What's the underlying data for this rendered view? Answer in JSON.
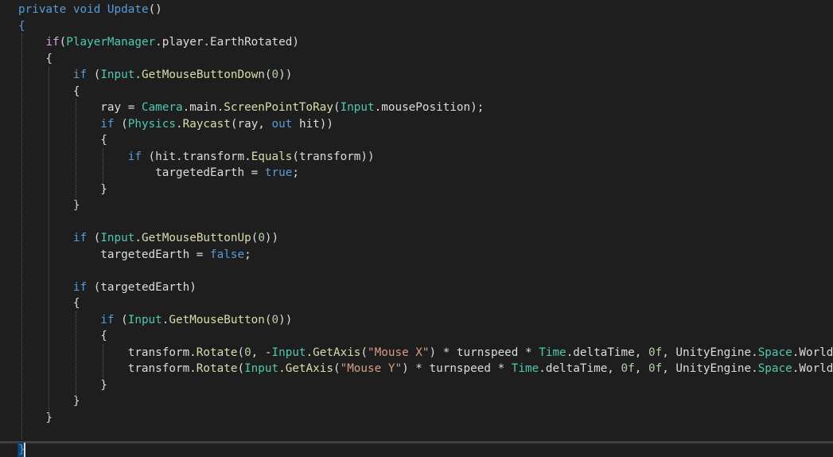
{
  "editor": {
    "lines": [
      {
        "tokens": [
          {
            "t": "private",
            "c": "kw"
          },
          {
            "t": " ",
            "c": "plain"
          },
          {
            "t": "void",
            "c": "kw"
          },
          {
            "t": " ",
            "c": "plain"
          },
          {
            "t": "Update",
            "c": "kw"
          },
          {
            "t": "()",
            "c": "plain"
          }
        ]
      },
      {
        "tokens": [
          {
            "t": "{",
            "c": "kw"
          }
        ]
      },
      {
        "tokens": [
          {
            "t": "    ",
            "c": "plain"
          },
          {
            "t": "if",
            "c": "ctl"
          },
          {
            "t": "(",
            "c": "plain"
          },
          {
            "t": "PlayerManager",
            "c": "ty"
          },
          {
            "t": ".player.EarthRotated)",
            "c": "plain"
          }
        ]
      },
      {
        "tokens": [
          {
            "t": "    {",
            "c": "plain"
          }
        ]
      },
      {
        "tokens": [
          {
            "t": "        ",
            "c": "plain"
          },
          {
            "t": "if",
            "c": "kw"
          },
          {
            "t": " (",
            "c": "plain"
          },
          {
            "t": "Input",
            "c": "ty"
          },
          {
            "t": ".",
            "c": "plain"
          },
          {
            "t": "GetMouseButtonDown",
            "c": "fn"
          },
          {
            "t": "(",
            "c": "plain"
          },
          {
            "t": "0",
            "c": "num"
          },
          {
            "t": "))",
            "c": "plain"
          }
        ]
      },
      {
        "tokens": [
          {
            "t": "        {",
            "c": "plain"
          }
        ]
      },
      {
        "tokens": [
          {
            "t": "            ray = ",
            "c": "plain"
          },
          {
            "t": "Camera",
            "c": "ty"
          },
          {
            "t": ".main.",
            "c": "plain"
          },
          {
            "t": "ScreenPointToRay",
            "c": "fn"
          },
          {
            "t": "(",
            "c": "plain"
          },
          {
            "t": "Input",
            "c": "ty"
          },
          {
            "t": ".mousePosition);",
            "c": "plain"
          }
        ]
      },
      {
        "tokens": [
          {
            "t": "            ",
            "c": "plain"
          },
          {
            "t": "if",
            "c": "kw"
          },
          {
            "t": " (",
            "c": "plain"
          },
          {
            "t": "Physics",
            "c": "ty"
          },
          {
            "t": ".",
            "c": "plain"
          },
          {
            "t": "Raycast",
            "c": "fn"
          },
          {
            "t": "(ray, ",
            "c": "plain"
          },
          {
            "t": "out",
            "c": "kw"
          },
          {
            "t": " hit))",
            "c": "plain"
          }
        ]
      },
      {
        "tokens": [
          {
            "t": "            {",
            "c": "plain"
          }
        ]
      },
      {
        "tokens": [
          {
            "t": "                ",
            "c": "plain"
          },
          {
            "t": "if",
            "c": "kw"
          },
          {
            "t": " (hit.transform.",
            "c": "plain"
          },
          {
            "t": "Equals",
            "c": "fn"
          },
          {
            "t": "(transform))",
            "c": "plain"
          }
        ]
      },
      {
        "tokens": [
          {
            "t": "                    targetedEarth = ",
            "c": "plain"
          },
          {
            "t": "true",
            "c": "kw"
          },
          {
            "t": ";",
            "c": "plain"
          }
        ]
      },
      {
        "tokens": [
          {
            "t": "            }",
            "c": "plain"
          }
        ]
      },
      {
        "tokens": [
          {
            "t": "        }",
            "c": "plain"
          }
        ]
      },
      {
        "tokens": [
          {
            "t": "",
            "c": "plain"
          }
        ]
      },
      {
        "tokens": [
          {
            "t": "        ",
            "c": "plain"
          },
          {
            "t": "if",
            "c": "kw"
          },
          {
            "t": " (",
            "c": "plain"
          },
          {
            "t": "Input",
            "c": "ty"
          },
          {
            "t": ".",
            "c": "plain"
          },
          {
            "t": "GetMouseButtonUp",
            "c": "fn"
          },
          {
            "t": "(",
            "c": "plain"
          },
          {
            "t": "0",
            "c": "num"
          },
          {
            "t": "))",
            "c": "plain"
          }
        ]
      },
      {
        "tokens": [
          {
            "t": "            targetedEarth = ",
            "c": "plain"
          },
          {
            "t": "false",
            "c": "kw"
          },
          {
            "t": ";",
            "c": "plain"
          }
        ]
      },
      {
        "tokens": [
          {
            "t": "",
            "c": "plain"
          }
        ]
      },
      {
        "tokens": [
          {
            "t": "        ",
            "c": "plain"
          },
          {
            "t": "if",
            "c": "kw"
          },
          {
            "t": " (targetedEarth)",
            "c": "plain"
          }
        ]
      },
      {
        "tokens": [
          {
            "t": "        {",
            "c": "plain"
          }
        ]
      },
      {
        "tokens": [
          {
            "t": "            ",
            "c": "plain"
          },
          {
            "t": "if",
            "c": "kw"
          },
          {
            "t": " (",
            "c": "plain"
          },
          {
            "t": "Input",
            "c": "ty"
          },
          {
            "t": ".",
            "c": "plain"
          },
          {
            "t": "GetMouseButton",
            "c": "fn"
          },
          {
            "t": "(",
            "c": "plain"
          },
          {
            "t": "0",
            "c": "num"
          },
          {
            "t": "))",
            "c": "plain"
          }
        ]
      },
      {
        "tokens": [
          {
            "t": "            {",
            "c": "plain"
          }
        ]
      },
      {
        "tokens": [
          {
            "t": "                transform.",
            "c": "plain"
          },
          {
            "t": "Rotate",
            "c": "fn"
          },
          {
            "t": "(",
            "c": "plain"
          },
          {
            "t": "0",
            "c": "num"
          },
          {
            "t": ", -",
            "c": "plain"
          },
          {
            "t": "Input",
            "c": "ty"
          },
          {
            "t": ".",
            "c": "plain"
          },
          {
            "t": "GetAxis",
            "c": "fn"
          },
          {
            "t": "(",
            "c": "plain"
          },
          {
            "t": "\"Mouse X\"",
            "c": "str"
          },
          {
            "t": ") * turnspeed * ",
            "c": "plain"
          },
          {
            "t": "Time",
            "c": "ty"
          },
          {
            "t": ".deltaTime, ",
            "c": "plain"
          },
          {
            "t": "0f",
            "c": "num"
          },
          {
            "t": ", UnityEngine.",
            "c": "plain"
          },
          {
            "t": "Space",
            "c": "ty"
          },
          {
            "t": ".World",
            "c": "plain"
          }
        ]
      },
      {
        "tokens": [
          {
            "t": "                transform.",
            "c": "plain"
          },
          {
            "t": "Rotate",
            "c": "fn"
          },
          {
            "t": "(",
            "c": "plain"
          },
          {
            "t": "Input",
            "c": "ty"
          },
          {
            "t": ".",
            "c": "plain"
          },
          {
            "t": "GetAxis",
            "c": "fn"
          },
          {
            "t": "(",
            "c": "plain"
          },
          {
            "t": "\"Mouse Y\"",
            "c": "str"
          },
          {
            "t": ") * turnspeed * ",
            "c": "plain"
          },
          {
            "t": "Time",
            "c": "ty"
          },
          {
            "t": ".deltaTime, ",
            "c": "plain"
          },
          {
            "t": "0f",
            "c": "num"
          },
          {
            "t": ", ",
            "c": "plain"
          },
          {
            "t": "0f",
            "c": "num"
          },
          {
            "t": ", UnityEngine.",
            "c": "plain"
          },
          {
            "t": "Space",
            "c": "ty"
          },
          {
            "t": ".World",
            "c": "plain"
          }
        ]
      },
      {
        "tokens": [
          {
            "t": "            }",
            "c": "plain"
          }
        ]
      },
      {
        "tokens": [
          {
            "t": "        }",
            "c": "plain"
          }
        ]
      },
      {
        "tokens": [
          {
            "t": "    }",
            "c": "plain"
          }
        ]
      }
    ],
    "closing_line": {
      "tokens": [
        {
          "t": "}",
          "c": "kw"
        }
      ]
    }
  }
}
